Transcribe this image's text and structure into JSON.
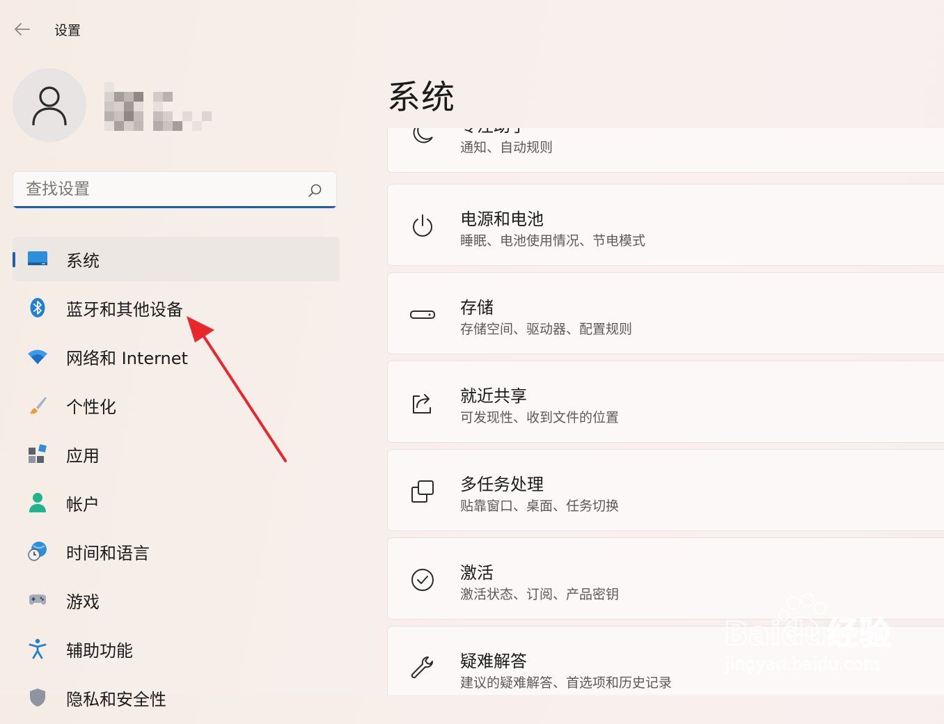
{
  "window": {
    "title": "设置"
  },
  "search": {
    "placeholder": "查找设置"
  },
  "sidebar": {
    "items": [
      {
        "label": "系统",
        "icon": "monitor-icon",
        "selected": true
      },
      {
        "label": "蓝牙和其他设备",
        "icon": "bluetooth-icon"
      },
      {
        "label": "网络和 Internet",
        "icon": "wifi-icon"
      },
      {
        "label": "个性化",
        "icon": "paintbrush-icon"
      },
      {
        "label": "应用",
        "icon": "apps-icon"
      },
      {
        "label": "帐户",
        "icon": "person-icon"
      },
      {
        "label": "时间和语言",
        "icon": "globe-clock-icon"
      },
      {
        "label": "游戏",
        "icon": "gamepad-icon"
      },
      {
        "label": "辅助功能",
        "icon": "accessibility-icon"
      },
      {
        "label": "隐私和安全性",
        "icon": "shield-icon"
      }
    ]
  },
  "main": {
    "title": "系统",
    "cards": [
      {
        "title": "专注助手",
        "desc": "通知、自动规则",
        "icon": "moon-icon"
      },
      {
        "title": "电源和电池",
        "desc": "睡眠、电池使用情况、节电模式",
        "icon": "power-icon"
      },
      {
        "title": "存储",
        "desc": "存储空间、驱动器、配置规则",
        "icon": "drive-icon"
      },
      {
        "title": "就近共享",
        "desc": "可发现性、收到文件的位置",
        "icon": "share-icon"
      },
      {
        "title": "多任务处理",
        "desc": "贴靠窗口、桌面、任务切换",
        "icon": "multitask-icon"
      },
      {
        "title": "激活",
        "desc": "激活状态、订阅、产品密钥",
        "icon": "check-circle-icon"
      },
      {
        "title": "疑难解答",
        "desc": "建议的疑难解答、首选项和历史记录",
        "icon": "wrench-icon"
      }
    ]
  },
  "watermark": {
    "brand": "Baidu经验",
    "url": "jingyan.baidu.com"
  },
  "colors": {
    "accent": "#1e5fa6",
    "annotation": "#e8262b"
  }
}
